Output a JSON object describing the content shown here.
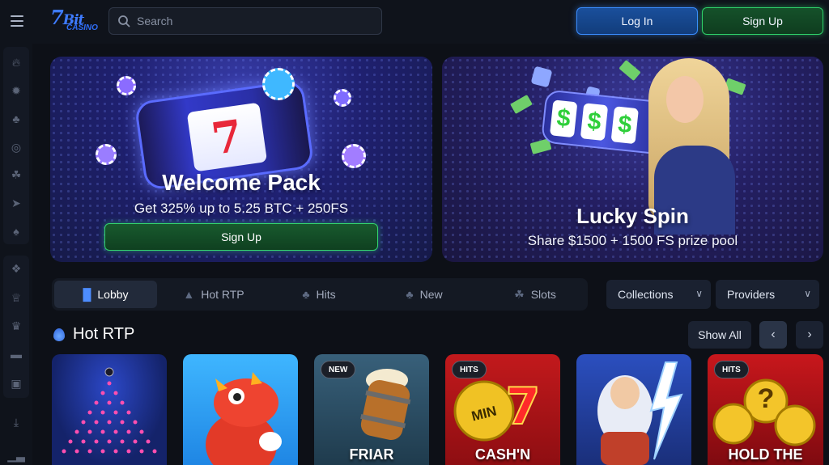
{
  "header": {
    "logo_text": "7BitCasino",
    "search_placeholder": "Search",
    "login_label": "Log In",
    "signup_label": "Sign Up"
  },
  "sidebar": {
    "icons": [
      "fire-icon",
      "star-burst-icon",
      "hits-icon",
      "target-icon",
      "slots-icon",
      "rocket-icon",
      "card-icon",
      "gift-icon",
      "trophy-icon",
      "crown-icon",
      "ticket-icon",
      "chest-icon",
      "download-icon",
      "chart-icon"
    ]
  },
  "banners": [
    {
      "title": "Welcome Pack",
      "subtitle": "Get 325% up to 5.25 BTC + 250FS",
      "button_label": "Sign Up"
    },
    {
      "title": "Lucky Spin",
      "subtitle": "Share $1500 + 1500 FS prize pool"
    }
  ],
  "tabs": [
    {
      "label": "Lobby",
      "icon": "lobby-icon",
      "active": true
    },
    {
      "label": "Hot RTP",
      "icon": "fire-icon",
      "active": false
    },
    {
      "label": "Hits",
      "icon": "hits-icon",
      "active": false
    },
    {
      "label": "New",
      "icon": "new-icon",
      "active": false
    },
    {
      "label": "Slots",
      "icon": "slots-icon",
      "active": false
    }
  ],
  "filters": {
    "collections_label": "Collections",
    "providers_label": "Providers"
  },
  "section": {
    "title": "Hot RTP",
    "show_all_label": "Show All"
  },
  "games": [
    {
      "badge": "",
      "title": ""
    },
    {
      "badge": "",
      "title": ""
    },
    {
      "badge": "NEW",
      "title": "FRIAR"
    },
    {
      "badge": "HITS",
      "title": "CASH'N",
      "art_text": "MIN"
    },
    {
      "badge": "",
      "title": ""
    },
    {
      "badge": "HITS",
      "title": "HOLD THE",
      "art_text": "?"
    }
  ],
  "colors": {
    "background": "#0d1017",
    "login_accent": "#3a8dff",
    "signup_accent": "#2fd16a"
  }
}
